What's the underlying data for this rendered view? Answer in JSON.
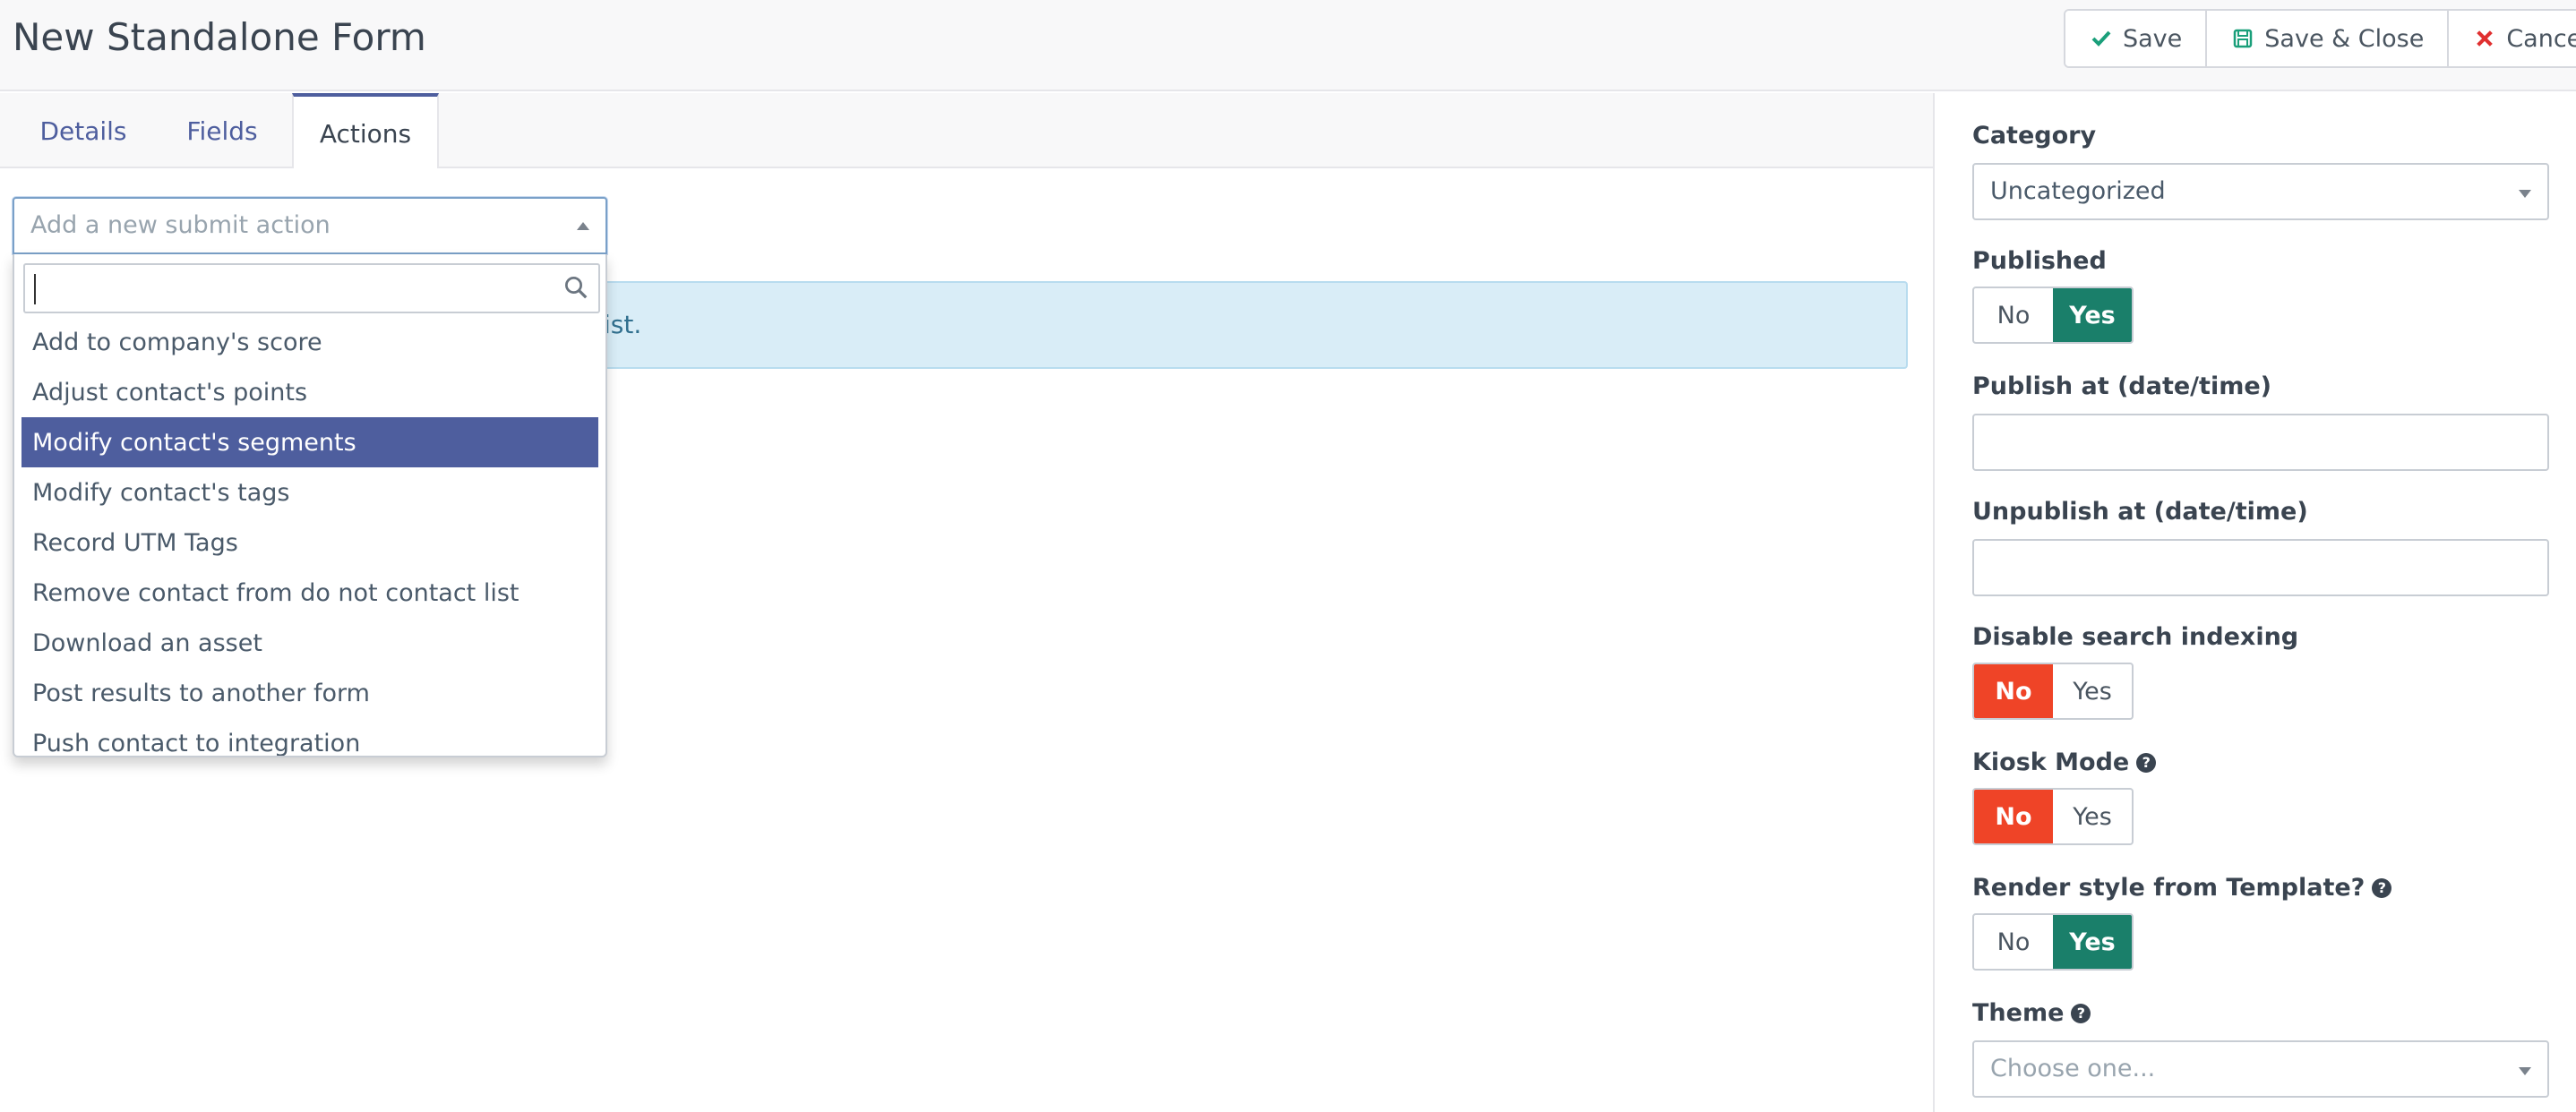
{
  "header": {
    "title": "New Standalone Form",
    "buttons": {
      "save": "Save",
      "save_close": "Save & Close",
      "cancel": "Cancel"
    }
  },
  "tabs": [
    "Details",
    "Fields",
    "Actions"
  ],
  "active_tab": "Actions",
  "actions": {
    "select_placeholder": "Add a new submit action",
    "search_value": "",
    "options": [
      "Add to company's score",
      "Adjust contact's points",
      "Modify contact's segments",
      "Modify contact's tags",
      "Record UTM Tags",
      "Remove contact from do not contact list",
      "Download an asset",
      "Post results to another form",
      "Push contact to integration"
    ],
    "highlighted_option": "Modify contact's segments",
    "info_text_visible": "ist."
  },
  "sidebar": {
    "category": {
      "label": "Category",
      "value": "Uncategorized"
    },
    "published": {
      "label": "Published",
      "no": "No",
      "yes": "Yes",
      "selected": "Yes"
    },
    "publish_up": {
      "label": "Publish at (date/time)",
      "value": ""
    },
    "publish_down": {
      "label": "Unpublish at (date/time)",
      "value": ""
    },
    "no_index": {
      "label": "Disable search indexing",
      "no": "No",
      "yes": "Yes",
      "selected": "No"
    },
    "kiosk_mode": {
      "label": "Kiosk Mode",
      "no": "No",
      "yes": "Yes",
      "selected": "No"
    },
    "render_style": {
      "label": "Render style from Template?",
      "no": "No",
      "yes": "Yes",
      "selected": "Yes"
    },
    "theme": {
      "label": "Theme",
      "placeholder": "Choose one..."
    }
  },
  "colors": {
    "accent": "#4e5e9e",
    "yes_active": "#1a7f6a",
    "no_active": "#ef4427",
    "info_bg": "#d9edf7"
  }
}
